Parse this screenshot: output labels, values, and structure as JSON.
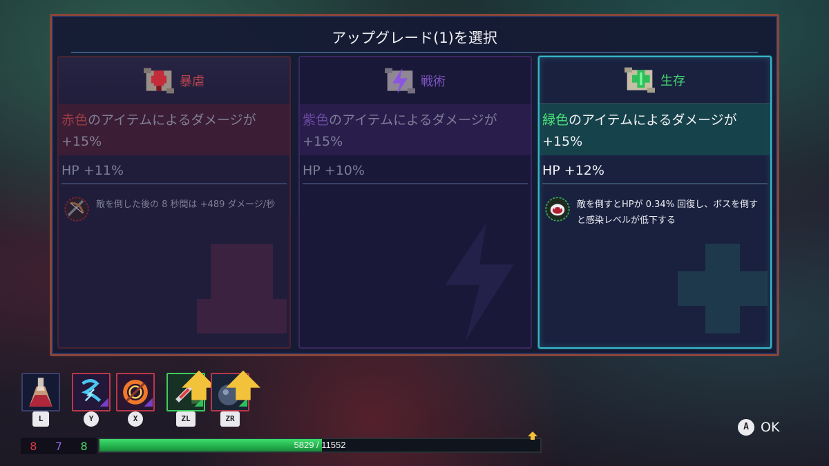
{
  "dialog": {
    "title": "アップグレード(1)を選択"
  },
  "cards": [
    {
      "id": "tyranny",
      "name": "暴虐",
      "icon": "red-fist-scroll-icon",
      "stat_accent": "赤色",
      "stat_text": "のアイテムによるダメージが+15%",
      "hp": "HP +11%",
      "perk_icon": "crossbow-icon",
      "perk_text": "敵を倒した後の 8 秒間は +489 ダメージ/秒",
      "color": "#b8454f"
    },
    {
      "id": "tactics",
      "name": "戦術",
      "icon": "purple-bolt-scroll-icon",
      "stat_accent": "紫色",
      "stat_text": "のアイテムによるダメージが+15%",
      "hp": "HP +10%",
      "color": "#7d55bf"
    },
    {
      "id": "survival",
      "name": "生存",
      "icon": "green-cross-scroll-icon",
      "stat_accent": "緑色",
      "stat_text": "のアイテムによるダメージが+15%",
      "hp": "HP +12%",
      "perk_icon": "vampire-mouth-icon",
      "perk_text": "敵を倒すとHPが 0.34% 回復し、ボスを倒すと感染レベルが低下する",
      "color": "#44d871",
      "selected": true
    }
  ],
  "hud": {
    "slots": [
      {
        "key": "L",
        "icon": "health-flask-icon"
      },
      {
        "key": "Y",
        "icon": "lightning-whip-icon"
      },
      {
        "key": "X",
        "icon": "fire-ring-icon"
      },
      {
        "key": "ZL",
        "icon": "syringe-turret-icon",
        "upgradable": true
      },
      {
        "key": "ZR",
        "icon": "bomb-icon",
        "upgradable": true
      }
    ],
    "scrolls": {
      "red": "8",
      "purple": "7",
      "green": "8"
    },
    "health": {
      "current": "5829",
      "separator": "/",
      "max": "11552",
      "fraction": 0.5046
    },
    "confirm": {
      "button": "A",
      "label": "OK"
    }
  },
  "colors": {
    "frame": "#8a4636",
    "selected_border": "#37b3c8",
    "health_green": "#3edc6c"
  }
}
